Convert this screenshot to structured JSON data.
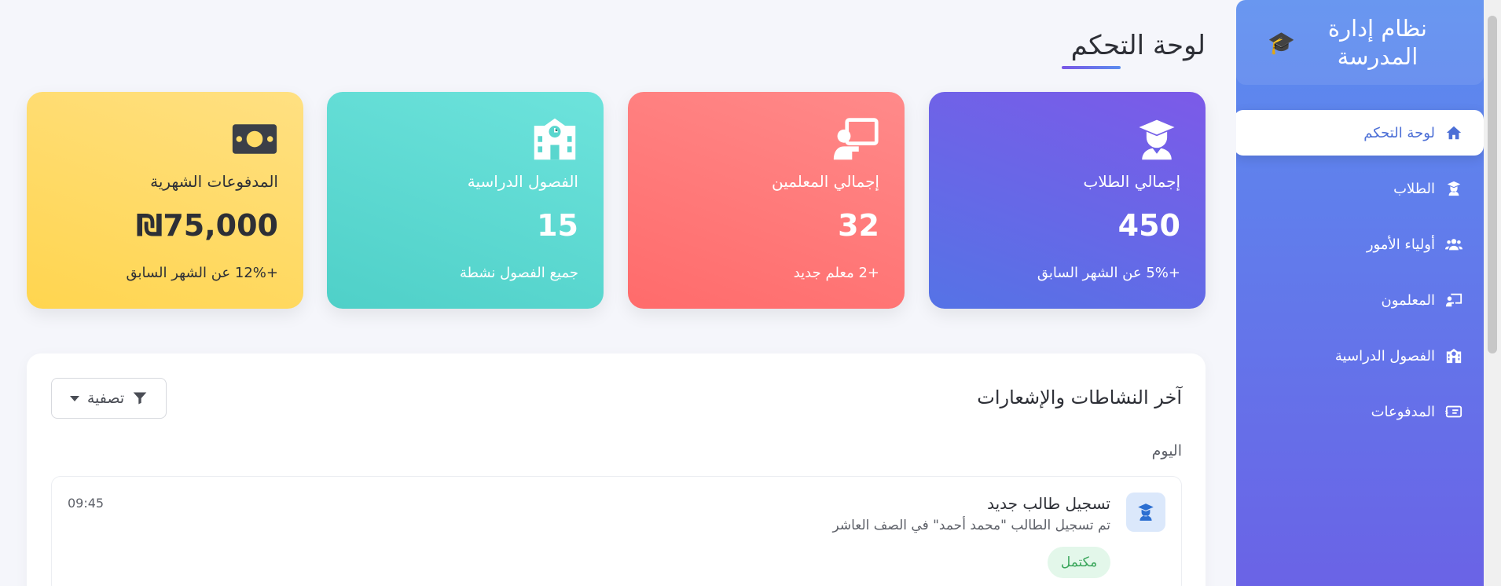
{
  "app": {
    "title": "نظام إدارة المدرسة",
    "logo_icon": "graduation-cap-icon"
  },
  "sidebar": {
    "items": [
      {
        "label": "لوحة التحكم",
        "icon": "home-icon",
        "active": true
      },
      {
        "label": "الطلاب",
        "icon": "student-icon",
        "active": false
      },
      {
        "label": "أولياء الأمور",
        "icon": "users-icon",
        "active": false
      },
      {
        "label": "المعلمون",
        "icon": "teacher-board-icon",
        "active": false
      },
      {
        "label": "الفصول الدراسية",
        "icon": "school-icon",
        "active": false
      },
      {
        "label": "المدفوعات",
        "icon": "money-card-icon",
        "active": false
      }
    ]
  },
  "page": {
    "title": "لوحة التحكم"
  },
  "stats": {
    "students": {
      "label": "إجمالي الطلاب",
      "value": "450",
      "note": "+5% عن الشهر السابق",
      "icon": "graduate-icon"
    },
    "teachers": {
      "label": "إجمالي المعلمين",
      "value": "32",
      "note": "+2 معلم جديد",
      "icon": "teacher-board-icon"
    },
    "classes": {
      "label": "الفصول الدراسية",
      "value": "15",
      "note": "جميع الفصول نشطة",
      "icon": "school-icon"
    },
    "payments": {
      "label": "المدفوعات الشهرية",
      "value": "₪75,000",
      "note": "+12% عن الشهر السابق",
      "icon": "money-bill-icon"
    }
  },
  "activities": {
    "title": "آخر النشاطات والإشعارات",
    "filter_label": "تصفية",
    "day_label": "اليوم",
    "items": [
      {
        "title": "تسجيل طالب جديد",
        "description": "تم تسجيل الطالب \"محمد أحمد\" في الصف العاشر",
        "time": "09:45",
        "status": "مكتمل",
        "icon": "student-icon"
      }
    ]
  },
  "colors": {
    "sidebar_top": "#5b8def",
    "sidebar_bottom": "#6a63e6",
    "accent": "#4c6fd6",
    "card_students": "#6b66e8",
    "card_teachers": "#ff7575",
    "card_classes": "#5fdbd3",
    "card_payments": "#ffdb66",
    "badge_success": "#3aa65b"
  }
}
